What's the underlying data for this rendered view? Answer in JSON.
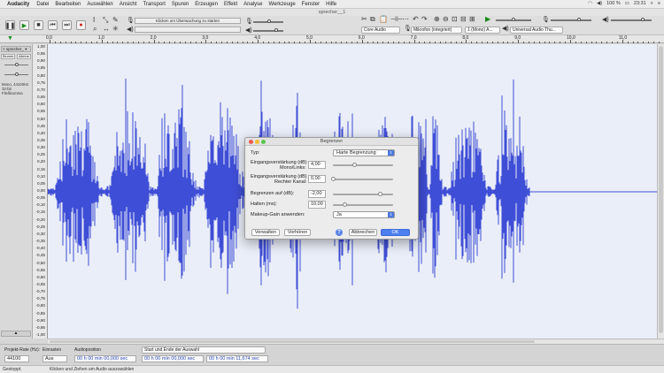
{
  "menubar": {
    "app": "Audacity",
    "items": [
      "Datei",
      "Bearbeiten",
      "Auswählen",
      "Ansicht",
      "Transport",
      "Spuren",
      "Erzeugen",
      "Effekt",
      "Analyse",
      "Werkzeuge",
      "Fenster",
      "Hilfe"
    ],
    "battery": "100 %",
    "clock": "23:31"
  },
  "window": {
    "title": "sprecher__1"
  },
  "toolbar": {
    "meter_hint": "Klicken um Überwachung zu starten",
    "audio_host": "Core Audio",
    "input_device": "Mikrofon (integriert)",
    "channels": "1 (Mono) A...",
    "output_device": "Universal Audio Thu..."
  },
  "ruler": {
    "ticks": [
      "0,0",
      "1,0",
      "2,0",
      "3,0",
      "4,0",
      "5,0",
      "6,0",
      "7,0",
      "8,0",
      "9,0",
      "10,0",
      "11,0"
    ]
  },
  "track": {
    "name": "sprecher_",
    "mute": "Stumm",
    "solo": "Alleine",
    "info_line1": "Mono, 44100Hz",
    "info_line2": "32-bit Fließkomma"
  },
  "yaxis": [
    "1,00",
    "0,95",
    "0,90",
    "0,85",
    "0,80",
    "0,75",
    "0,70",
    "0,65",
    "0,60",
    "0,55",
    "0,50",
    "0,45",
    "0,40",
    "0,35",
    "0,30",
    "0,25",
    "0,20",
    "0,15",
    "0,10",
    "0,05",
    "0,00",
    "-0,05",
    "-0,10",
    "-0,15",
    "-0,20",
    "-0,25",
    "-0,30",
    "-0,35",
    "-0,40",
    "-0,45",
    "-0,50",
    "-0,55",
    "-0,60",
    "-0,65",
    "-0,70",
    "-0,75",
    "-0,80",
    "-0,85",
    "-0,90",
    "-0,95",
    "-1,00"
  ],
  "selection_bar": {
    "rate_label": "Projekt-Rate (Hz):",
    "rate_value": "44100",
    "snap_label": "Einrasten",
    "snap_value": "Aus",
    "pos_label": "Audioposition",
    "pos_value": "00 h 00 min 00,000 sec",
    "range_label": "Start und Ende der Auswahl",
    "start_value": "00 h 00 min 00,000 sec",
    "end_value": "00 h 00 min 11,674 sec"
  },
  "status": {
    "state": "Gestoppt.",
    "hint": "Klicken und Ziehen um Audio auszuwählen"
  },
  "dialog": {
    "title": "Begrenzer",
    "type_label": "Typ:",
    "type_value": "Harte Begrenzung",
    "gain_left_label1": "Eingangsverstärkung (dB)",
    "gain_left_label2": "Mono/Links:",
    "gain_left_value": "4,00",
    "gain_right_label1": "Eingangsverstärkung (dB)",
    "gain_right_label2": "Rechter Kanal:",
    "gain_right_value": "0,00",
    "limit_label": "Begrenzen auf (dB):",
    "limit_value": "-2,00",
    "hold_label": "Halten (ms):",
    "hold_value": "10,00",
    "makeup_label": "Makeup-Gain anwenden:",
    "makeup_value": "Ja",
    "manage_button": "Verwalten",
    "preview_button": "Vorhören",
    "help_icon_label": "?",
    "cancel_button": "Abbrechen",
    "ok_button": "OK",
    "levels": {
      "gain_left": 0.37,
      "gain_right": 0.0,
      "limit": 0.8,
      "hold": 0.19
    }
  },
  "colors": {
    "waveform": "#3f4ed6",
    "accent": "#4d7ff0"
  }
}
